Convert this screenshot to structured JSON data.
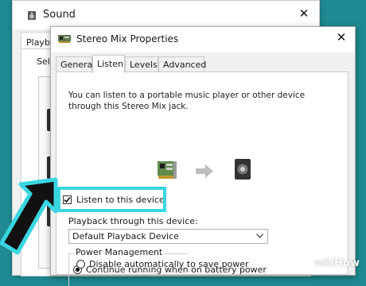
{
  "sound_window": {
    "title": "Sound",
    "tab_label": "Playba",
    "select_text": "Sele",
    "close_glyph": "✕"
  },
  "props_window": {
    "title": "Stereo Mix Properties",
    "close_glyph": "✕",
    "tabs": [
      "General",
      "Listen",
      "Levels",
      "Advanced"
    ],
    "active_tab": "Listen",
    "description": "You can listen to a portable music player or other device through this  Stereo Mix  jack.",
    "listen_checkbox": {
      "label": "Listen to this device",
      "checked": true
    },
    "playback_label": "Playback through this device:",
    "playback_value": "Default Playback Device",
    "power_management": {
      "legend": "Power Management",
      "options": [
        {
          "label": "Continue running when on battery power",
          "selected": true
        },
        {
          "label": "Disable automatically to save power",
          "selected": false
        }
      ]
    }
  },
  "highlight_color": "#39d6e2",
  "background_color": "#1f8a91",
  "watermark": {
    "prefix": "wiki",
    "suffix": "How"
  }
}
